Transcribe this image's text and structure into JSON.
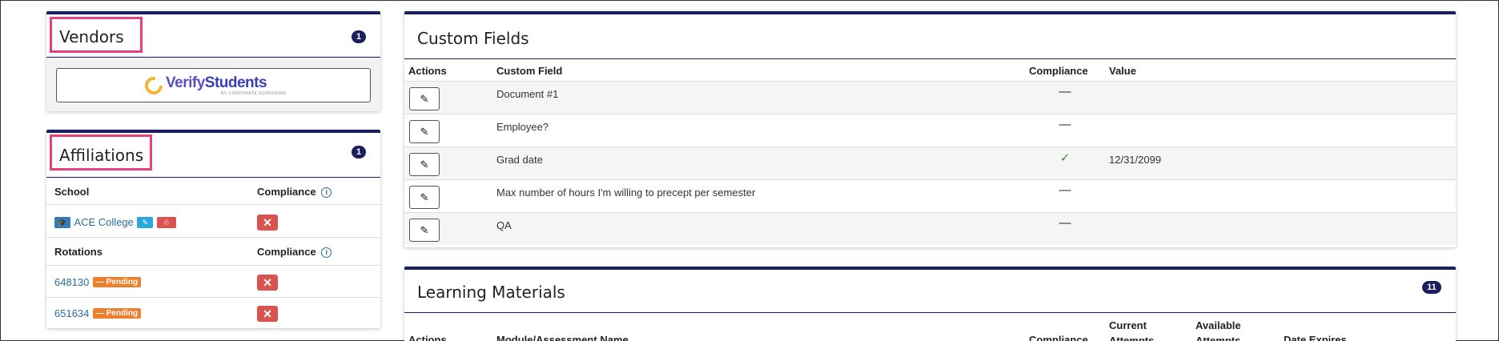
{
  "vendors": {
    "title": "Vendors",
    "count": "1",
    "logo_text_verify": "Verify",
    "logo_text_students": "Students",
    "logo_subtext": "BY CORPORATE SCREENING"
  },
  "affiliations": {
    "title": "Affiliations",
    "count": "1",
    "school_header": "School",
    "compliance_header": "Compliance",
    "school_name": "ACE College",
    "rotations_header": "Rotations",
    "rotations_compliance_header": "Compliance",
    "rotations": [
      {
        "id": "648130",
        "status": "— Pending"
      },
      {
        "id": "651634",
        "status": "— Pending"
      }
    ],
    "x_symbol": "✕"
  },
  "custom_fields": {
    "title": "Custom Fields",
    "headers": {
      "actions": "Actions",
      "field": "Custom Field",
      "compliance": "Compliance",
      "value": "Value"
    },
    "rows": [
      {
        "field": "Document #1",
        "compliance": "—",
        "value": ""
      },
      {
        "field": "Employee?",
        "compliance": "—",
        "value": ""
      },
      {
        "field": "Grad date",
        "compliance": "✓",
        "value": "12/31/2099"
      },
      {
        "field": "Max number of hours I'm willing to precept per semester",
        "compliance": "—",
        "value": ""
      },
      {
        "field": "QA",
        "compliance": "—",
        "value": ""
      }
    ]
  },
  "learning_materials": {
    "title": "Learning Materials",
    "count": "11",
    "headers": {
      "actions": "Actions",
      "module": "Module/Assessment Name",
      "compliance": "Compliance",
      "current_attempts": "Current Attempts",
      "available_attempts": "Available Attempts",
      "date_expires": "Date Expires"
    }
  },
  "colors": {
    "accent_navy": "#1c1f5e",
    "highlight_pink": "#e8407c",
    "danger_red": "#d9534f",
    "pending_orange": "#ee7f2d",
    "link_blue": "#2a6b9c"
  }
}
